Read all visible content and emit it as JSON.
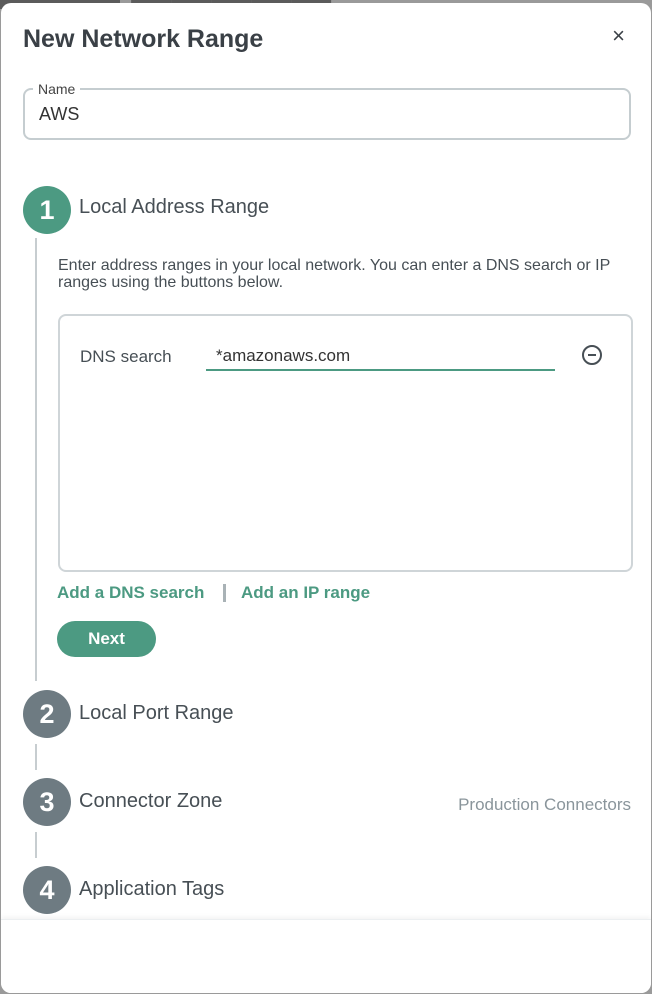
{
  "dialog": {
    "title": "New Network Range",
    "close_glyph": "×"
  },
  "name_field": {
    "label": "Name",
    "value": "AWS"
  },
  "steps": [
    {
      "number": "1",
      "label": "Local Address Range",
      "state": "active"
    },
    {
      "number": "2",
      "label": "Local Port Range",
      "state": "inactive"
    },
    {
      "number": "3",
      "label": "Connector Zone",
      "state": "inactive",
      "value": "Production Connectors"
    },
    {
      "number": "4",
      "label": "Application Tags",
      "state": "inactive"
    }
  ],
  "address_range": {
    "description": "Enter address ranges in your local network. You can enter a DNS search or IP ranges using the buttons below.",
    "entries": [
      {
        "type_label": "DNS search",
        "value": "*amazonaws.com",
        "remove_icon": "minus-circle-icon"
      }
    ],
    "add_dns_label": "Add a DNS search",
    "add_ip_label": "Add an IP range",
    "next_label": "Next"
  },
  "colors": {
    "accent": "#4c9a82",
    "inactive_step": "#6e7b82",
    "text": "#474f55"
  }
}
